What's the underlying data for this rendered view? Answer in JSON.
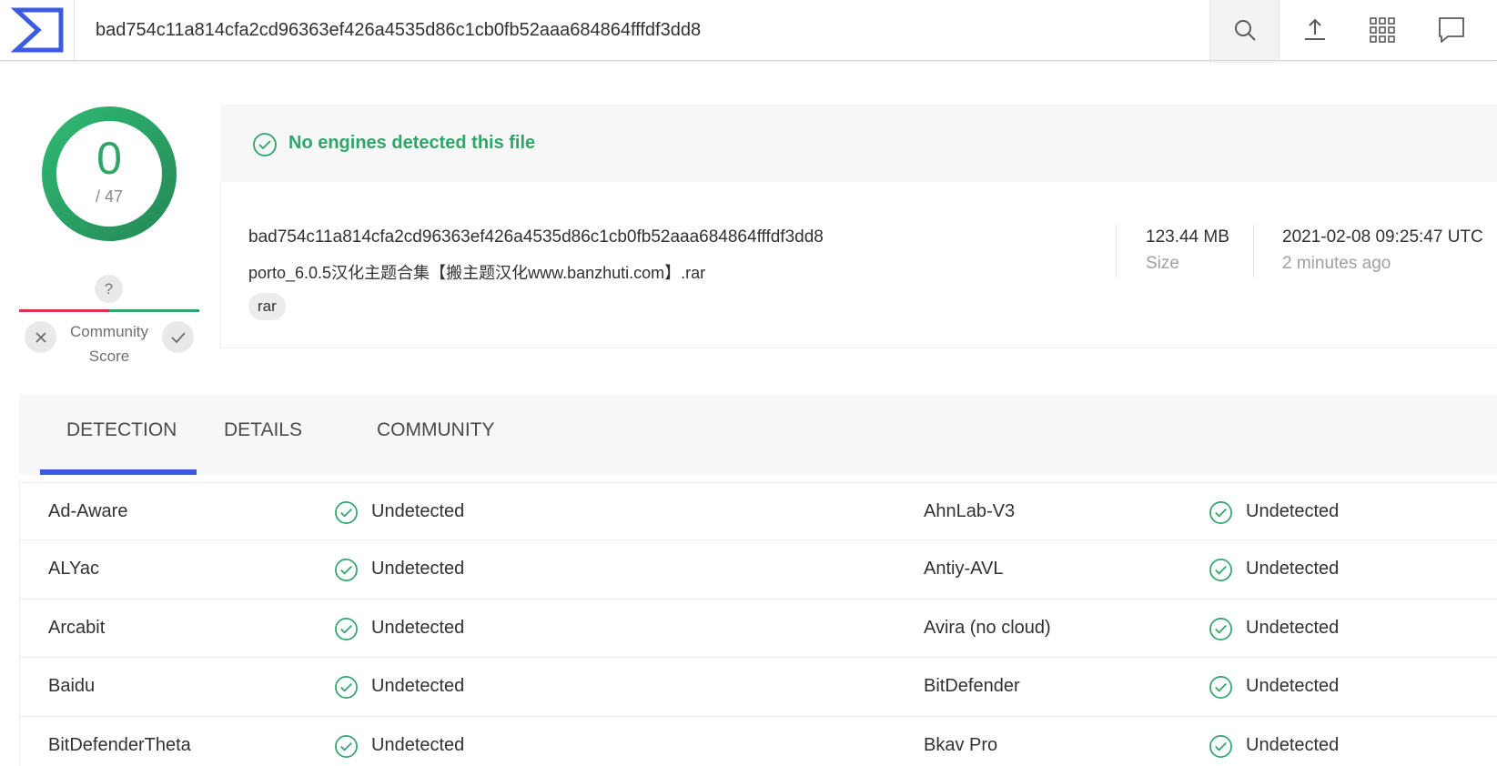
{
  "header": {
    "search_value": "bad754c11a814cfa2cd96363ef426a4535d86c1cb0fb52aaa684864fffdf3dd8",
    "icons": [
      "vt-logo-icon",
      "search-icon",
      "upload-icon",
      "apps-grid-icon",
      "chat-icon"
    ]
  },
  "score": {
    "detections": "0",
    "total": "/ 47",
    "ring_color": "#2fa56a"
  },
  "community": {
    "unknown_mark": "?",
    "label_line1": "Community",
    "label_line2": "Score"
  },
  "summary": {
    "banner": "No engines detected this file",
    "hash": "bad754c11a814cfa2cd96363ef426a4535d86c1cb0fb52aaa684864fffdf3dd8",
    "file_name": "porto_6.0.5汉化主题合集【搬主题汉化www.banzhuti.com】.rar",
    "tag": "rar",
    "size_value": "123.44 MB",
    "size_label": "Size",
    "date_value": "2021-02-08 09:25:47 UTC",
    "date_ago": "2 minutes ago"
  },
  "tabs": {
    "detection": "DETECTION",
    "details": "DETAILS",
    "community": "COMMUNITY",
    "active": "DETECTION"
  },
  "detections": [
    {
      "left_engine": "Ad-Aware",
      "left_status": "Undetected",
      "right_engine": "AhnLab-V3",
      "right_status": "Undetected"
    },
    {
      "left_engine": "ALYac",
      "left_status": "Undetected",
      "right_engine": "Antiy-AVL",
      "right_status": "Undetected"
    },
    {
      "left_engine": "Arcabit",
      "left_status": "Undetected",
      "right_engine": "Avira (no cloud)",
      "right_status": "Undetected"
    },
    {
      "left_engine": "Baidu",
      "left_status": "Undetected",
      "right_engine": "BitDefender",
      "right_status": "Undetected"
    },
    {
      "left_engine": "BitDefenderTheta",
      "left_status": "Undetected",
      "right_engine": "Bkav Pro",
      "right_status": "Undetected"
    }
  ],
  "colors": {
    "accent_green": "#2fa56a",
    "accent_blue": "#3d5be0",
    "alert_red": "#e0304e"
  }
}
